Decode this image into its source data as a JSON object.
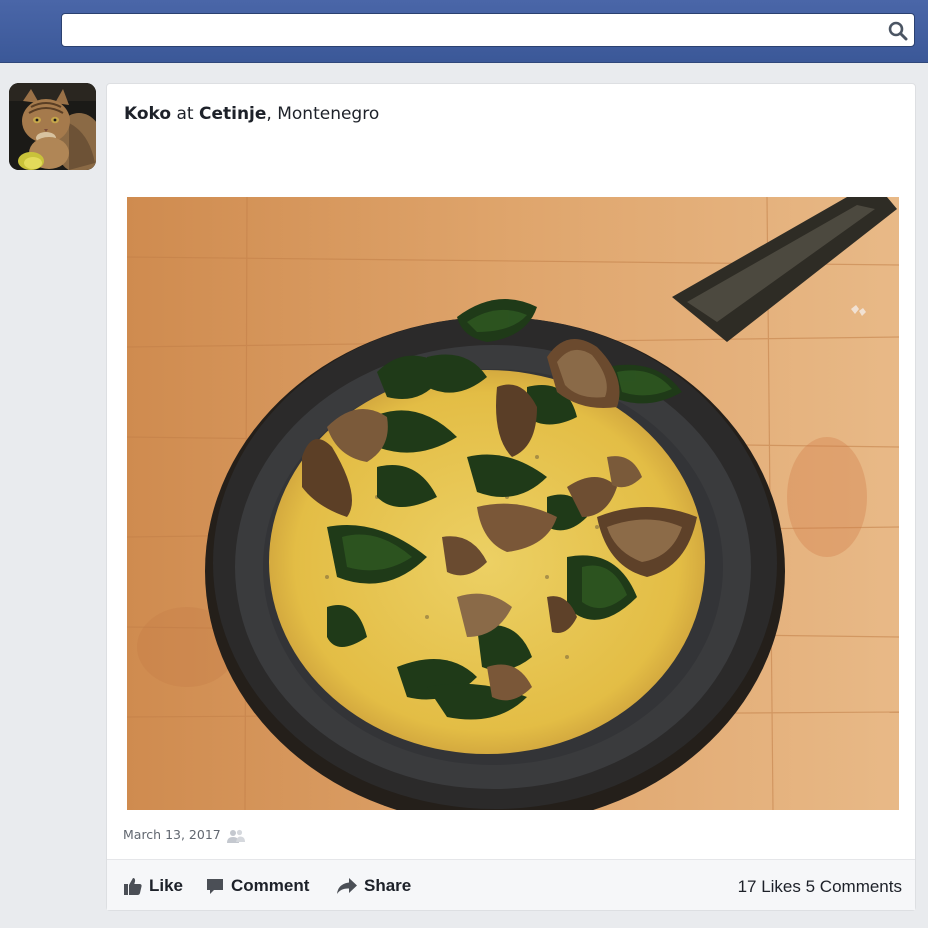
{
  "search": {
    "placeholder": "",
    "value": ""
  },
  "post": {
    "author": "Koko",
    "at_word": "at",
    "place": "Cetinje",
    "region": ", Montenegro",
    "date": "March 13, 2017",
    "audience_icon": "friends-icon"
  },
  "actions": {
    "like_label": "Like",
    "comment_label": "Comment",
    "share_label": "Share"
  },
  "stats": {
    "likes": "17 Likes",
    "comments": "5 Comments"
  },
  "colors": {
    "topbar": "#3b5898",
    "page_bg": "#e9ebee",
    "card_bg": "#ffffff",
    "action_bar_bg": "#f6f7f9"
  }
}
